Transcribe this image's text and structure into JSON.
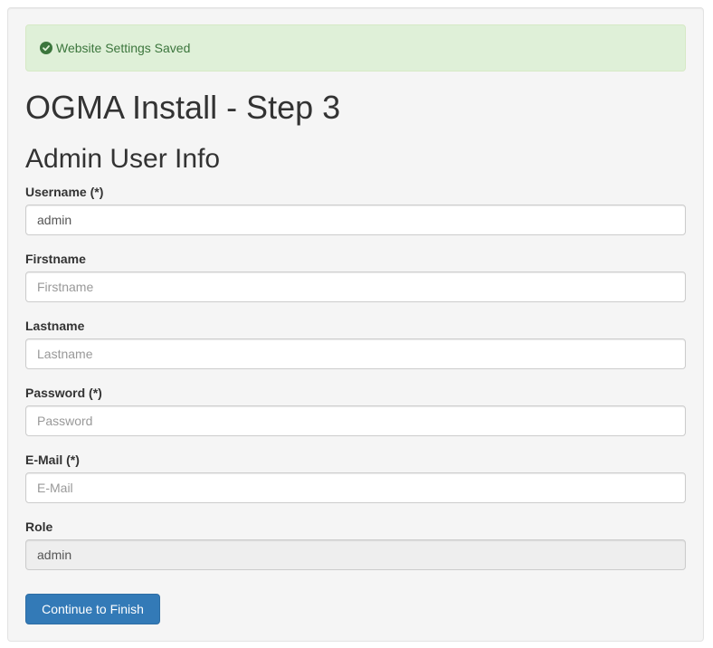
{
  "alert": {
    "icon": "check-circle-icon",
    "message": "Website Settings Saved",
    "color": "#3c763d",
    "background": "#dff0d8"
  },
  "page_title": "OGMA Install - Step 3",
  "section_title": "Admin User Info",
  "form": {
    "username": {
      "label": "Username (*)",
      "value": "admin",
      "placeholder": ""
    },
    "firstname": {
      "label": "Firstname",
      "value": "",
      "placeholder": "Firstname"
    },
    "lastname": {
      "label": "Lastname",
      "value": "",
      "placeholder": "Lastname"
    },
    "password": {
      "label": "Password (*)",
      "value": "",
      "placeholder": "Password"
    },
    "email": {
      "label": "E-Mail (*)",
      "value": "",
      "placeholder": "E-Mail"
    },
    "role": {
      "label": "Role",
      "value": "admin"
    }
  },
  "submit": {
    "label": "Continue to Finish",
    "color": "#337ab7"
  }
}
